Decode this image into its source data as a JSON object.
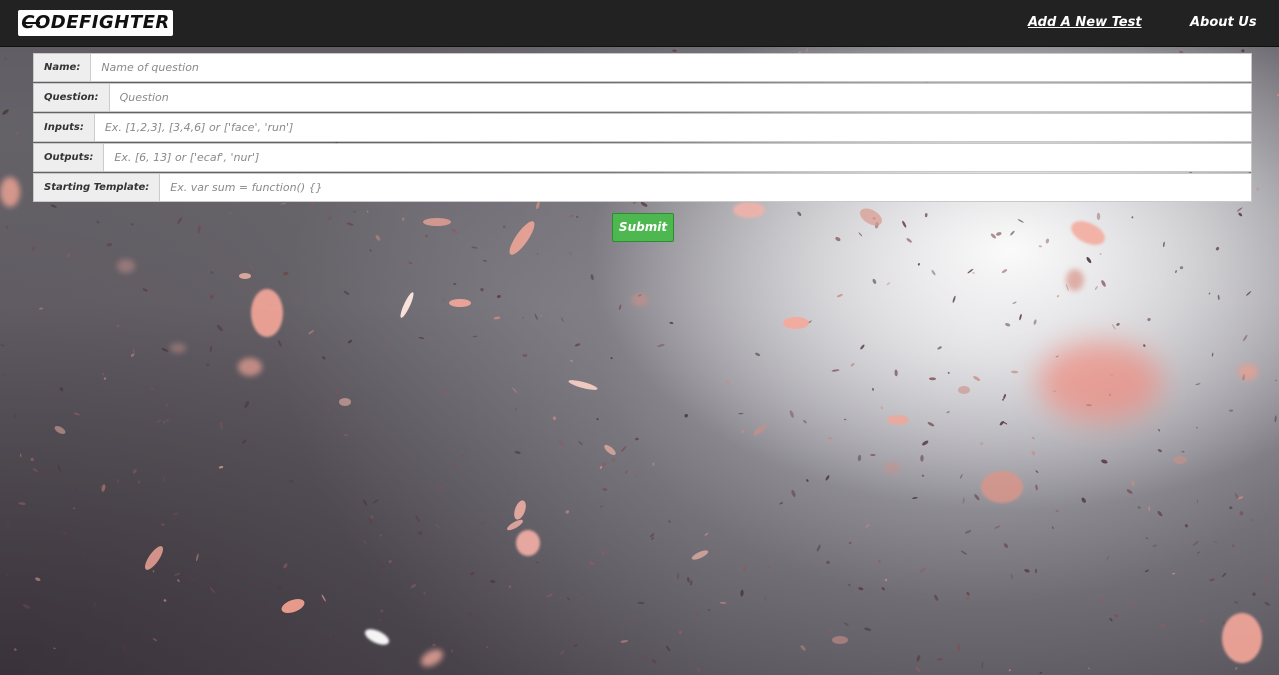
{
  "navbar": {
    "brand": "CODEFIGHTER",
    "links": [
      {
        "label": "Add A New Test"
      },
      {
        "label": "About Us"
      }
    ]
  },
  "form": {
    "fields": [
      {
        "label": "Name:",
        "value": "",
        "placeholder": "Name of question"
      },
      {
        "label": "Question:",
        "value": "",
        "placeholder": "Question"
      },
      {
        "label": "Inputs:",
        "value": "",
        "placeholder": "Ex. [1,2,3], [3,4,6] or ['face', 'run']"
      },
      {
        "label": "Outputs:",
        "value": "",
        "placeholder": "Ex. [6, 13] or ['ecaf', 'nur']"
      },
      {
        "label": "Starting Template:",
        "value": "",
        "placeholder": "Ex. var sum = function() {}"
      }
    ],
    "submit_label": "Submit"
  },
  "colors": {
    "navbar_bg": "#222222",
    "submit_bg": "#4cb84f",
    "petal_pink": "#f4a99b"
  },
  "background": "cherry blossom petals falling (decorative)"
}
